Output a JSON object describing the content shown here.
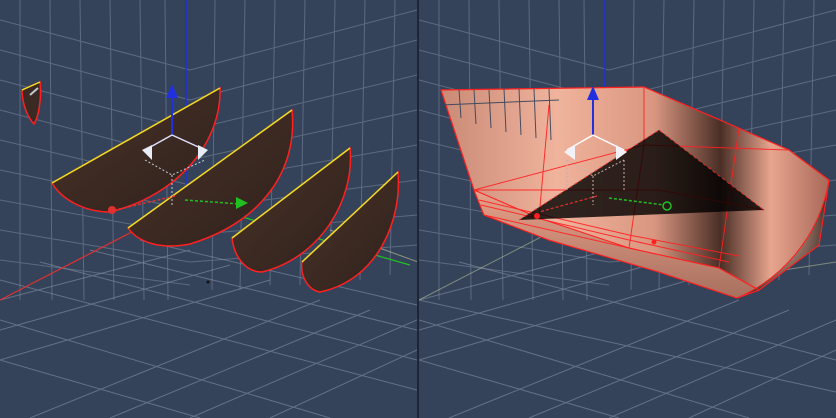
{
  "viewports": [
    {
      "id": "left",
      "mode": "wireframe-sections",
      "description_color": "#3b2a24",
      "object": "hull-cross-section-curves"
    },
    {
      "id": "right",
      "mode": "lofted-surface",
      "description_color": "#e6a18a",
      "object": "lofted-hull-surface"
    }
  ],
  "colors": {
    "background": "#35435a",
    "grid": "#8290a6",
    "axis_x": "#e03030",
    "axis_y": "#20c020",
    "axis_z": "#2030e0",
    "highlight_edge": "#e8e020",
    "selection_edge": "#ff2020",
    "section_fill": "#3b2a24",
    "hull_surface": "#e6a18a"
  },
  "icons": [
    "move-gizmo-icon",
    "rotate-gizmo-icon",
    "pivot-icon"
  ]
}
